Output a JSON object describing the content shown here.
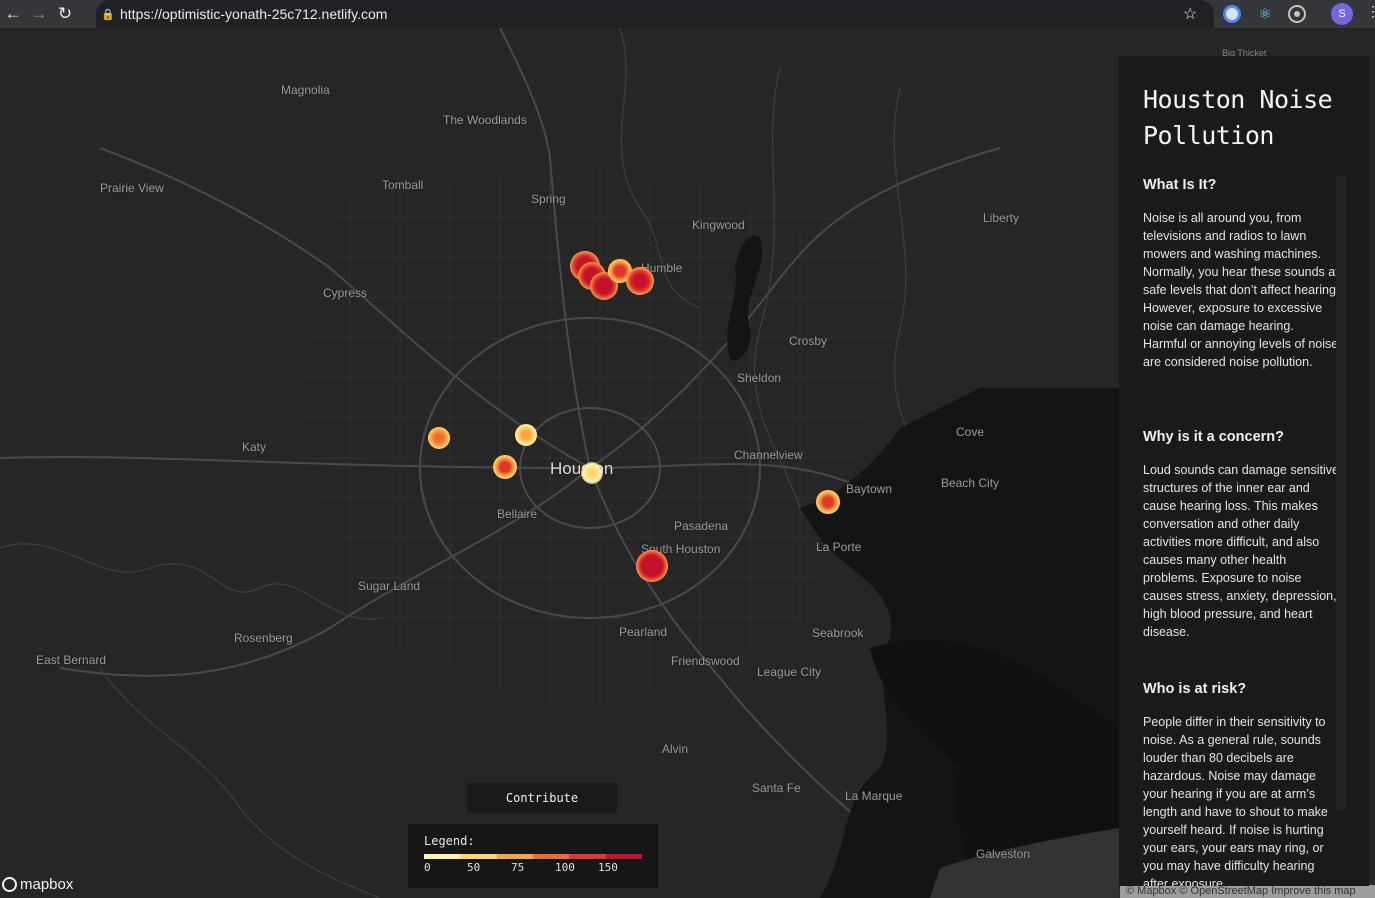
{
  "browser": {
    "url": "https://optimistic-yonath-25c712.netlify.com",
    "profile_initial": "S"
  },
  "map": {
    "places": {
      "magnolia": "Magnolia",
      "the_woodlands": "The Woodlands",
      "prairie_view": "Prairie View",
      "tomball": "Tomball",
      "spring": "Spring",
      "kingwood": "Kingwood",
      "liberty": "Liberty",
      "humble": "Humble",
      "cypress": "Cypress",
      "crosby": "Crosby",
      "sheldon": "Sheldon",
      "katy": "Katy",
      "houston": "Houston",
      "channelview": "Channelview",
      "cove": "Cove",
      "baytown": "Baytown",
      "beach_city": "Beach City",
      "bellaire": "Bellaire",
      "pasadena": "Pasadena",
      "south_houston": "South Houston",
      "la_porte": "La Porte",
      "sugar_land": "Sugar Land",
      "rosenberg": "Rosenberg",
      "east_bernard": "East Bernard",
      "pearland": "Pearland",
      "seabrook": "Seabrook",
      "friendswood": "Friendswood",
      "league_city": "League City",
      "alvin": "Alvin",
      "santa_fe": "Santa Fe",
      "la_marque": "La Marque",
      "galveston": "Galveston",
      "big_thicket": "Big Thicket"
    },
    "contribute_label": "Contribute",
    "legend": {
      "title": "Legend:",
      "ticks": [
        "0",
        "50",
        "75",
        "100",
        "150"
      ],
      "colors": [
        "#fff3b0",
        "#fdd76b",
        "#f7a441",
        "#f06a34",
        "#e0362c",
        "#c4122a"
      ]
    },
    "logo_text": "mapbox",
    "attribution": "© Mapbox © OpenStreetMap Improve this map"
  },
  "panel": {
    "title": "Houston Noise Pollution",
    "sections": [
      {
        "heading": "What Is It?",
        "text": "Noise is all around you, from televisions and radios to lawn mowers and washing machines. Normally, you hear these sounds at safe levels that don’t affect hearing. However, exposure to excessive noise can damage hearing. Harmful or annoying levels of noise are considered noise pollution."
      },
      {
        "heading": "Why is it a concern?",
        "text": "Loud sounds can damage sensitive structures of the inner ear and cause hearing loss. This makes conversation and other daily activities more difficult, and also causes many other health problems. Exposure to noise causes stress, anxiety, depression, high blood pressure, and heart disease."
      },
      {
        "heading": "Who is at risk?",
        "text": "People differ in their sensitivity to noise. As a general rule, sounds louder than 80 decibels are hazardous. Noise may damage your hearing if you are at arm’s length and have to shout to make yourself heard. If noise is hurting your ears, your ears may ring, or you may have difficulty hearing after exposure."
      }
    ]
  }
}
